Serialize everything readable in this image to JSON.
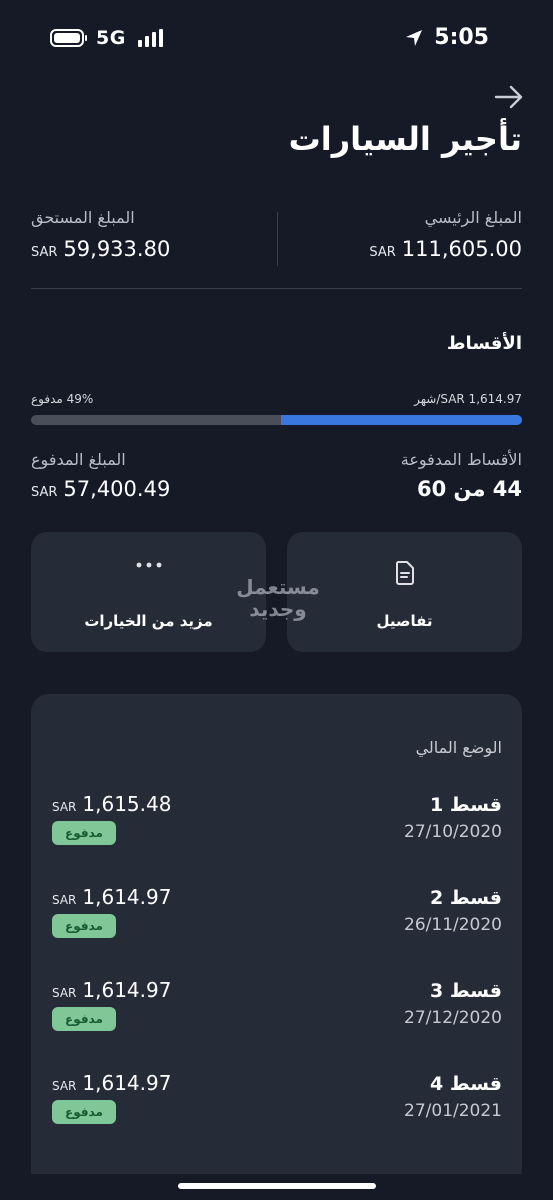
{
  "status_bar": {
    "network": "5G",
    "time": "5:05"
  },
  "header": {
    "title": "تأجير السيارات"
  },
  "summary": {
    "principal_label": "المبلغ الرئيسي",
    "principal_currency": "SAR",
    "principal_value": "111,605.00",
    "due_label": "المبلغ المستحق",
    "due_currency": "SAR",
    "due_value": "59,933.80"
  },
  "installments": {
    "heading": "الأقساط",
    "monthly_label": "SAR 1,614.97/شهر",
    "paid_percent_label": "49% مدفوع",
    "paid_fraction": 0.49,
    "paid_installments_label": "الأقساط المدفوعة",
    "paid_installments_value": "44 من 60",
    "paid_amount_label": "المبلغ المدفوع",
    "paid_amount_currency": "SAR",
    "paid_amount_value": "57,400.49"
  },
  "actions": {
    "details_label": "تفاصيل",
    "more_label": "مزيد من الخيارات"
  },
  "watermark": {
    "line1": "مستعمل",
    "line2": "وجديد"
  },
  "financial_status": {
    "title": "الوضع المالي",
    "items": [
      {
        "name": "قسط 1",
        "date": "27/10/2020",
        "currency": "SAR",
        "amount": "1,615.48",
        "status": "مدفوع"
      },
      {
        "name": "قسط 2",
        "date": "26/11/2020",
        "currency": "SAR",
        "amount": "1,614.97",
        "status": "مدفوع"
      },
      {
        "name": "قسط 3",
        "date": "27/12/2020",
        "currency": "SAR",
        "amount": "1,614.97",
        "status": "مدفوع"
      },
      {
        "name": "قسط 4",
        "date": "27/01/2021",
        "currency": "SAR",
        "amount": "1,614.97",
        "status": "مدفوع"
      }
    ]
  },
  "colors": {
    "background": "#161a26",
    "card": "#262b38",
    "progress_fill": "#3a78e0",
    "progress_track": "#4a4e58",
    "paid_badge_bg": "#7fc796",
    "paid_badge_text": "#185a31"
  },
  "icons": {
    "back": "arrow-right-icon",
    "details": "document-icon",
    "more": "ellipsis-icon",
    "location": "location-arrow-icon",
    "battery": "battery-icon",
    "signal": "signal-bars-icon"
  }
}
